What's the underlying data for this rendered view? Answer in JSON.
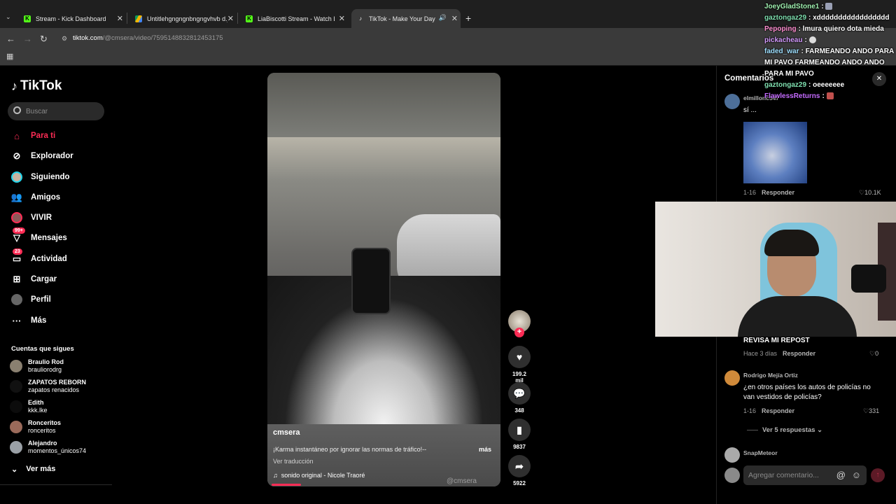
{
  "browser": {
    "tabs": [
      {
        "label": "Stream - Kick Dashboard",
        "icon": "kick-icon",
        "color": "#53fc18"
      },
      {
        "label": "Untitlehgngngnbngngvhvb d.jp",
        "icon": "google-drive-icon",
        "color": "#f4b400"
      },
      {
        "label": "LiaBiscotti Stream - Watch Live",
        "icon": "kick-icon",
        "color": "#53fc18"
      },
      {
        "label": "TikTok - Make Your Day",
        "icon": "tiktok-icon",
        "color": "#ffffff"
      }
    ],
    "url_host": "tiktok.com",
    "url_path": "/@cmsera/video/7595148832812453175"
  },
  "tiktok": {
    "logo": "TikTok",
    "search_placeholder": "Buscar",
    "nav": [
      {
        "label": "Para ti",
        "icon": "home-icon",
        "active": true
      },
      {
        "label": "Explorador",
        "icon": "compass-icon"
      },
      {
        "label": "Siguiendo",
        "icon": "following-avatar-icon"
      },
      {
        "label": "Amigos",
        "icon": "friends-icon"
      },
      {
        "label": "VIVIR",
        "icon": "live-icon"
      },
      {
        "label": "Mensajes",
        "icon": "messages-icon",
        "badge": "99+"
      },
      {
        "label": "Actividad",
        "icon": "activity-icon",
        "badge": "23"
      },
      {
        "label": "Cargar",
        "icon": "upload-icon"
      },
      {
        "label": "Perfil",
        "icon": "profile-avatar-icon"
      },
      {
        "label": "Más",
        "icon": "more-icon"
      }
    ],
    "following_title": "Cuentas que sigues",
    "following": [
      {
        "name": "Braulio Rod",
        "handle": "brauliorodrg"
      },
      {
        "name": "ZAPATOS REBORN",
        "handle": "zapatos renacidos"
      },
      {
        "name": "Edith",
        "handle": "kkk.lke"
      },
      {
        "name": "Ronceritos",
        "handle": "ronceritos"
      },
      {
        "name": "Alejandro",
        "handle": "momentos_únicos74"
      }
    ],
    "see_more": "Ver más",
    "video": {
      "username": "cmsera",
      "description": "¡Karma instantáneo por ignorar las normas de tráfico!--",
      "more": "más",
      "translate": "Ver traducción",
      "music": "sonido original - Nicole Traoré",
      "watermark": "@cmsera",
      "progress_fraction": 0.13
    },
    "actions": {
      "likes": "199.2 mil",
      "comments": "348",
      "saves": "9837",
      "shares": "5922"
    },
    "comments_panel": {
      "title": "Comentarios",
      "items": [
        {
          "user": "elmillonc547",
          "text": "sí ...",
          "date": "1-16",
          "reply": "Responder",
          "likes": "10.1K"
        },
        {
          "user": "",
          "text": "REVISA MI REPOST",
          "date": "Hace 3 días",
          "reply": "Responder",
          "likes": "0"
        },
        {
          "user": "Rodrigo Mejía Ortiz",
          "text": "¿en otros países los autos de policías no van vestidos de policías?",
          "date": "1-16",
          "reply": "Responder",
          "likes": "331"
        },
        {
          "user": "SnapMeteor",
          "text": "",
          "date": "",
          "reply": "",
          "likes": ""
        }
      ],
      "view_replies": "Ver 5 respuestas",
      "input_placeholder": "Agregar comentario..."
    }
  },
  "chat_overlay": [
    {
      "user": "JoeyGladStone1",
      "color": "#a0f0b0",
      "text": ":"
    },
    {
      "user": "gaztongaz29",
      "color": "#7fe0b0",
      "text": ": xddddddddddddddddd"
    },
    {
      "user": "Pepoping",
      "color": "#ff8ed0",
      "text": ": lmura quiero dota mieda"
    },
    {
      "user": "pickacheau",
      "color": "#d59bff",
      "text": ":"
    },
    {
      "user": "faded_war",
      "color": "#9fe0ff",
      "text": ": FARMEANDO ANDO PARA MI PAVO FARMEANDO ANDO ANDO PARA MI PAVO"
    },
    {
      "user": "gaztongaz29",
      "color": "#7fe0b0",
      "text": ": oeeeeeee"
    },
    {
      "user": "FlawlessReturns",
      "color": "#c56bff",
      "text": ":"
    }
  ]
}
